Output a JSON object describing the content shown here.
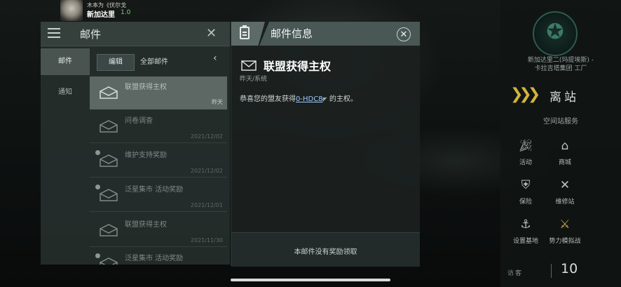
{
  "pilot": {
    "name": "木本为《伏尔戈",
    "location": "新加达里",
    "security": "1.0"
  },
  "mail_panel": {
    "title": "邮件",
    "side_tabs": [
      {
        "label": "邮件",
        "active": true
      },
      {
        "label": "通知",
        "active": false
      }
    ],
    "edit_label": "编辑",
    "filter_label": "全部邮件",
    "items": [
      {
        "subject": "联盟获得主权",
        "date": "昨天",
        "selected": true,
        "reward": false
      },
      {
        "subject": "问卷调查",
        "date": "2021/12/02",
        "selected": false,
        "reward": false
      },
      {
        "subject": "维护支持奖励",
        "date": "2021/12/02",
        "selected": false,
        "reward": true
      },
      {
        "subject": "泛星集市 活动奖励",
        "date": "2021/12/01",
        "selected": false,
        "reward": true
      },
      {
        "subject": "联盟获得主权",
        "date": "2021/11/30",
        "selected": false,
        "reward": false
      },
      {
        "subject": "泛星集市 活动奖励",
        "date": "",
        "selected": false,
        "reward": true
      }
    ]
  },
  "detail_panel": {
    "title": "邮件信息",
    "subject": "联盟获得主权",
    "meta": "昨天/系统",
    "body_prefix": "恭喜您的盟友获得",
    "body_link": "0-HDC8",
    "body_suffix": " 的主权。",
    "reward_status": "本邮件没有奖励领取"
  },
  "station": {
    "name_line1": "新加达里二(玛提埃斯) -",
    "name_line2": "卡拉吉塔集团 工厂",
    "undock_label": "离站",
    "services_title": "空间站服务",
    "services": [
      {
        "label": "活动",
        "icon": "party-popper-icon"
      },
      {
        "label": "商城",
        "icon": "shop-icon"
      },
      {
        "label": "保险",
        "icon": "insurance-icon"
      },
      {
        "label": "维修站",
        "icon": "repair-tools-icon"
      },
      {
        "label": "设置基地",
        "icon": "set-base-icon"
      },
      {
        "label": "势力模拟战",
        "icon": "faction-battle-icon"
      }
    ],
    "visitors_label": "访客",
    "visitors_count": "10"
  }
}
